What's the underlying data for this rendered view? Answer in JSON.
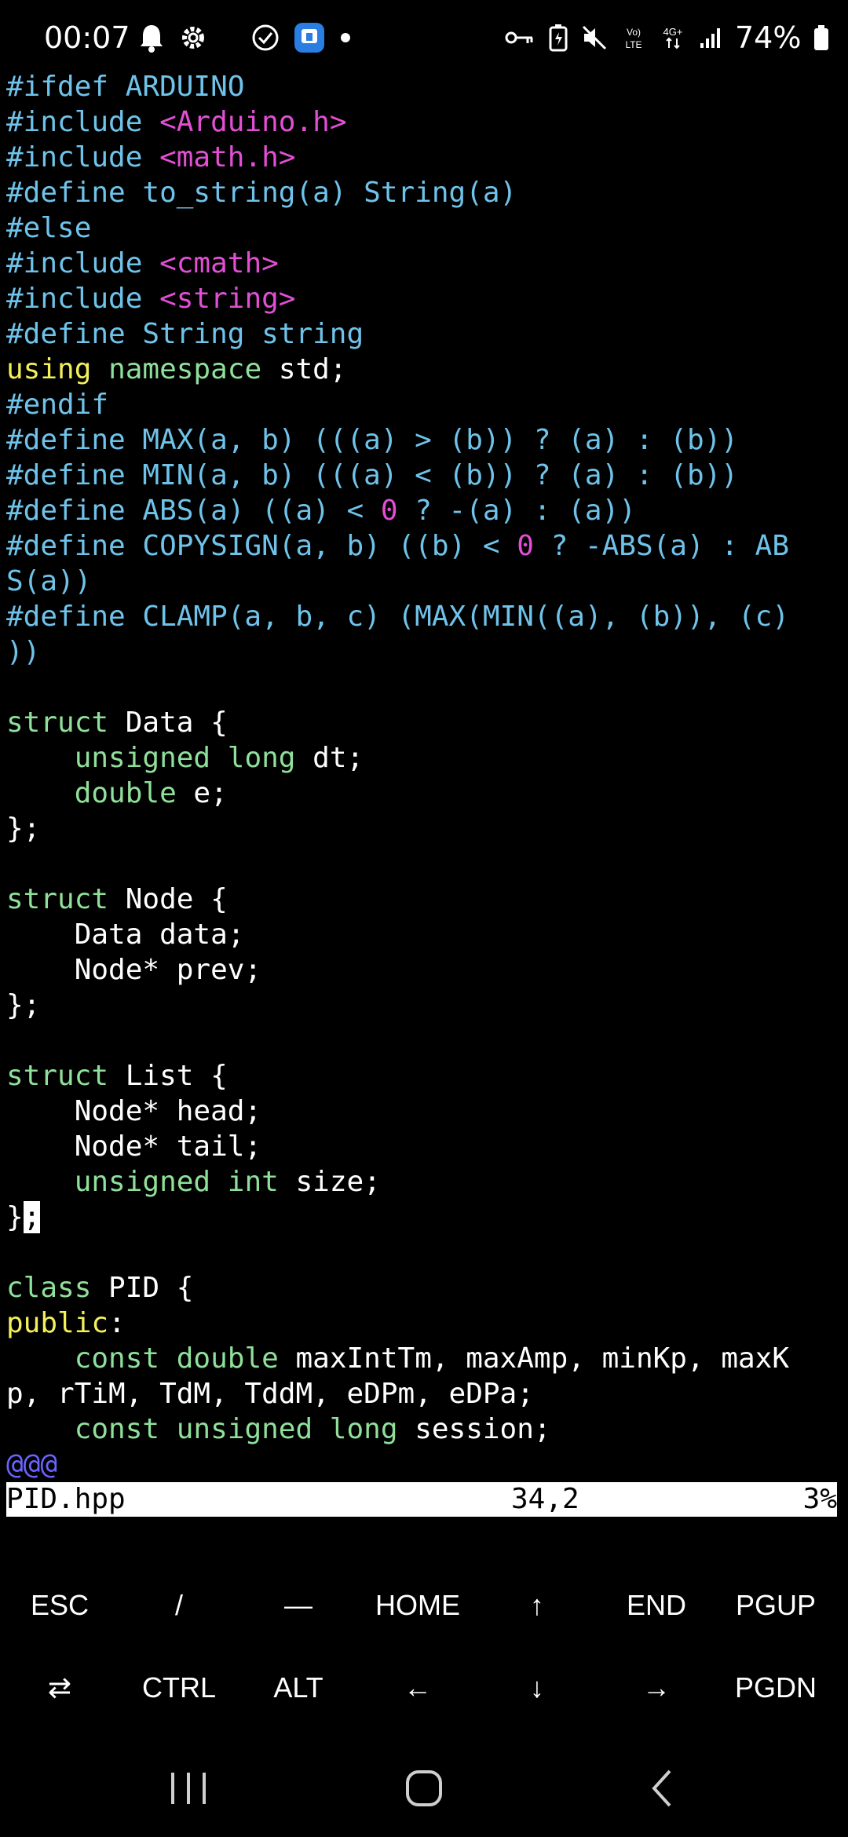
{
  "status_bar": {
    "time": "00:07",
    "battery": "74%",
    "icons_left": [
      "bell-icon",
      "gear-icon",
      "check-circle-icon",
      "app-icon",
      "dot-icon"
    ],
    "icons_right": [
      "key-icon",
      "battery-saver-icon",
      "mute-icon",
      "volte-icon",
      "4g-icon",
      "signal-icon",
      "battery-icon"
    ]
  },
  "editor": {
    "lines": [
      [
        {
          "t": "#ifdef ARDUINO",
          "c": "pp"
        }
      ],
      [
        {
          "t": "#include ",
          "c": "pp"
        },
        {
          "t": "<Arduino.h>",
          "c": "str"
        }
      ],
      [
        {
          "t": "#include ",
          "c": "pp"
        },
        {
          "t": "<math.h>",
          "c": "str"
        }
      ],
      [
        {
          "t": "#define to_string(a) String(a)",
          "c": "pp"
        }
      ],
      [
        {
          "t": "#else",
          "c": "pp"
        }
      ],
      [
        {
          "t": "#include ",
          "c": "pp"
        },
        {
          "t": "<cmath>",
          "c": "str"
        }
      ],
      [
        {
          "t": "#include ",
          "c": "pp"
        },
        {
          "t": "<string>",
          "c": "str"
        }
      ],
      [
        {
          "t": "#define String string",
          "c": "pp"
        }
      ],
      [
        {
          "t": "using",
          "c": "kw"
        },
        {
          "t": " ",
          "c": "wh"
        },
        {
          "t": "namespace",
          "c": "ty"
        },
        {
          "t": " std;",
          "c": "wh"
        }
      ],
      [
        {
          "t": "#endif",
          "c": "pp"
        }
      ],
      [
        {
          "t": "#define MAX(a, b) (((a) > (b)) ? (a) : (b))",
          "c": "pp"
        }
      ],
      [
        {
          "t": "#define MIN(a, b) (((a) < (b)) ? (a) : (b))",
          "c": "pp"
        }
      ],
      [
        {
          "t": "#define ABS(a) ((a) < ",
          "c": "pp"
        },
        {
          "t": "0",
          "c": "num"
        },
        {
          "t": " ? -(a) : (a))",
          "c": "pp"
        }
      ],
      [
        {
          "t": "#define COPYSIGN(a, b) ((b) < ",
          "c": "pp"
        },
        {
          "t": "0",
          "c": "num"
        },
        {
          "t": " ? -ABS(a) : AB",
          "c": "pp"
        }
      ],
      [
        {
          "t": "S(a))",
          "c": "pp"
        }
      ],
      [
        {
          "t": "#define CLAMP(a, b, c) (MAX(MIN((a), (b)), (c)",
          "c": "pp"
        }
      ],
      [
        {
          "t": "))",
          "c": "pp"
        }
      ],
      [],
      [
        {
          "t": "struct",
          "c": "ty"
        },
        {
          "t": " Data {",
          "c": "wh"
        }
      ],
      [
        {
          "t": "    ",
          "c": "wh"
        },
        {
          "t": "unsigned long",
          "c": "ty"
        },
        {
          "t": " dt;",
          "c": "wh"
        }
      ],
      [
        {
          "t": "    ",
          "c": "wh"
        },
        {
          "t": "double",
          "c": "ty"
        },
        {
          "t": " e;",
          "c": "wh"
        }
      ],
      [
        {
          "t": "};",
          "c": "wh"
        }
      ],
      [],
      [
        {
          "t": "struct",
          "c": "ty"
        },
        {
          "t": " Node {",
          "c": "wh"
        }
      ],
      [
        {
          "t": "    Data data;",
          "c": "wh"
        }
      ],
      [
        {
          "t": "    Node* prev;",
          "c": "wh"
        }
      ],
      [
        {
          "t": "};",
          "c": "wh"
        }
      ],
      [],
      [
        {
          "t": "struct",
          "c": "ty"
        },
        {
          "t": " List {",
          "c": "wh"
        }
      ],
      [
        {
          "t": "    Node* head;",
          "c": "wh"
        }
      ],
      [
        {
          "t": "    Node* tail;",
          "c": "wh"
        }
      ],
      [
        {
          "t": "    ",
          "c": "wh"
        },
        {
          "t": "unsigned int",
          "c": "ty"
        },
        {
          "t": " size;",
          "c": "wh"
        }
      ],
      [
        {
          "t": "}",
          "c": "wh"
        },
        {
          "t": ";",
          "c": "cursor"
        }
      ],
      [],
      [
        {
          "t": "class",
          "c": "ty"
        },
        {
          "t": " PID {",
          "c": "wh"
        }
      ],
      [
        {
          "t": "public",
          "c": "kw"
        },
        {
          "t": ":",
          "c": "wh"
        }
      ],
      [
        {
          "t": "    ",
          "c": "wh"
        },
        {
          "t": "const double",
          "c": "ty"
        },
        {
          "t": " maxIntTm, maxAmp, minKp, maxK",
          "c": "wh"
        }
      ],
      [
        {
          "t": "p, rTiM, TdM, TddM, eDPm, eDPa;",
          "c": "wh"
        }
      ],
      [
        {
          "t": "    ",
          "c": "wh"
        },
        {
          "t": "const unsigned long",
          "c": "ty"
        },
        {
          "t": " session;",
          "c": "wh"
        }
      ],
      [
        {
          "t": "@@@",
          "c": "tilde"
        }
      ]
    ]
  },
  "vim_status": {
    "filename": "PID.hpp",
    "position": "34,2",
    "percent": "3%"
  },
  "extra_keys": {
    "row1": [
      "ESC",
      "/",
      "—",
      "HOME",
      "↑",
      "END",
      "PGUP"
    ],
    "row2": [
      "⇄",
      "CTRL",
      "ALT",
      "←",
      "↓",
      "→",
      "PGDN"
    ]
  },
  "nav_bar": [
    "recents-icon",
    "home-icon",
    "back-icon"
  ]
}
